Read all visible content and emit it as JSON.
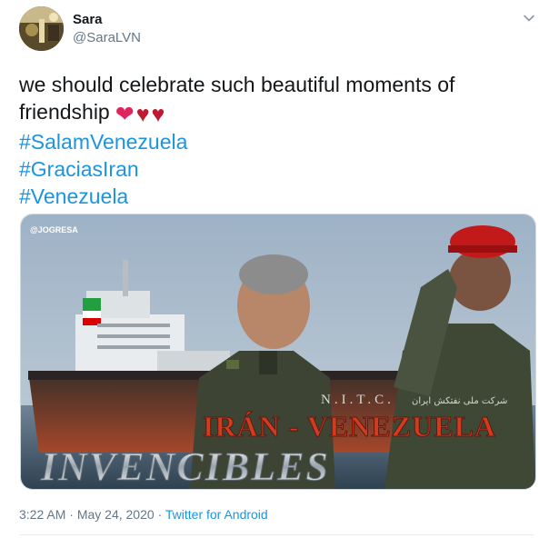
{
  "author": {
    "name": "Sara",
    "handle": "@SaraLVN"
  },
  "tweet": {
    "line1": "we should celebrate such beautiful moments of",
    "line2": "friendship",
    "hearts": [
      "❤",
      "♥",
      "♥"
    ],
    "hashtags": [
      "#SalamVenezuela",
      "#GraciasIran",
      "#Venezuela"
    ]
  },
  "media": {
    "watermark": "@JOGRESA",
    "hull_text": "N.I.T.C.",
    "farsi_text": "شرکت ملی نفتکش ایران",
    "headline": "IRÁN - VENEZUELA",
    "subheadline": "INVENCIBLES"
  },
  "meta": {
    "time": "3:22 AM",
    "separator1": "·",
    "date": "May 24, 2020",
    "separator2": "·",
    "source": "Twitter for Android"
  },
  "colors": {
    "link": "#1b95e0",
    "muted": "#657786",
    "heart_main": "#e0245e",
    "heart_dark": "#be1931"
  }
}
